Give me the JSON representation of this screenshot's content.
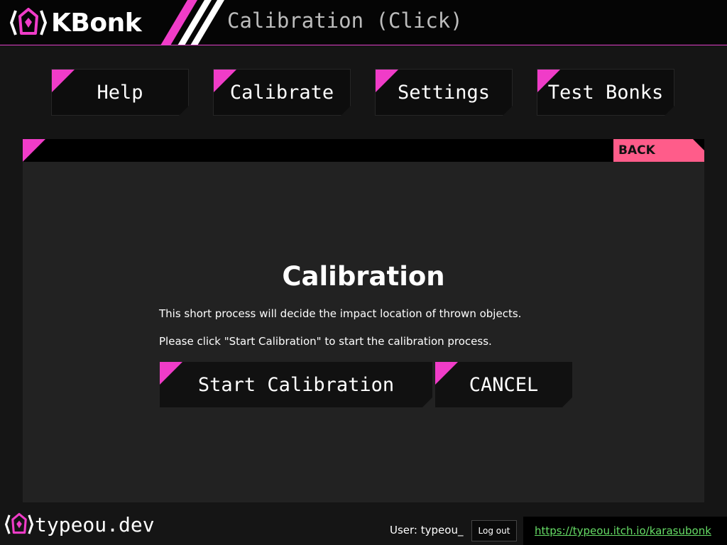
{
  "app": {
    "brand": "KBonk",
    "page_title": "Calibration (Click)"
  },
  "nav": [
    {
      "label": "Help"
    },
    {
      "label": "Calibrate"
    },
    {
      "label": "Settings"
    },
    {
      "label": "Test Bonks"
    }
  ],
  "panel": {
    "back_label": "BACK",
    "title": "Calibration",
    "description_1": "This short process will decide the impact location of thrown objects.",
    "description_2": "Please click \"Start Calibration\" to start the calibration process.",
    "start_label": "Start Calibration",
    "cancel_label": "CANCEL"
  },
  "footer": {
    "brand": "typeou.dev",
    "user_label": "User:",
    "username": "typeou_",
    "logout_label": "Log out",
    "link_text": "https://typeou.itch.io/karasubonk"
  },
  "colors": {
    "accent_pink": "#f03cc8",
    "back_pink": "#ff5c8a",
    "link_green": "#66dd66"
  },
  "icons": {
    "brand_logo": "hex-shield-logo-icon"
  }
}
